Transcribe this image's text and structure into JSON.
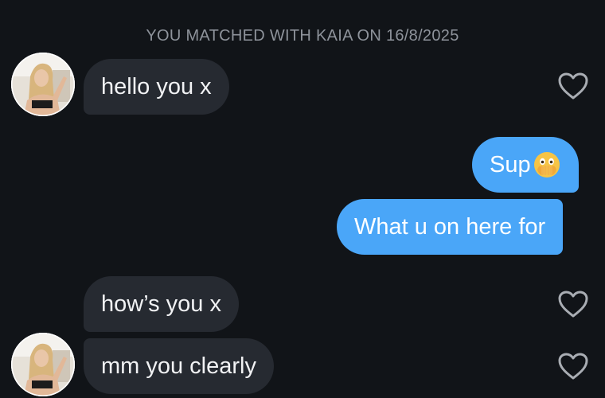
{
  "banner": "YOU MATCHED WITH KAIA ON 16/8/2025",
  "messages": {
    "m1": "hello you x",
    "m2": "Sup",
    "m2_emoji": "face-with-open-eyes-and-hand-over-mouth-emoji",
    "m3": "What u on here for",
    "m4": "how’s you x",
    "m5": "mm you clearly"
  },
  "colors": {
    "background": "#111418",
    "incoming_bubble": "#262a31",
    "outgoing_bubble": "#4aa6f8",
    "banner_text": "#8e939b"
  },
  "icons": {
    "like": "heart-outline-icon",
    "avatar": "kaia-profile-photo"
  }
}
